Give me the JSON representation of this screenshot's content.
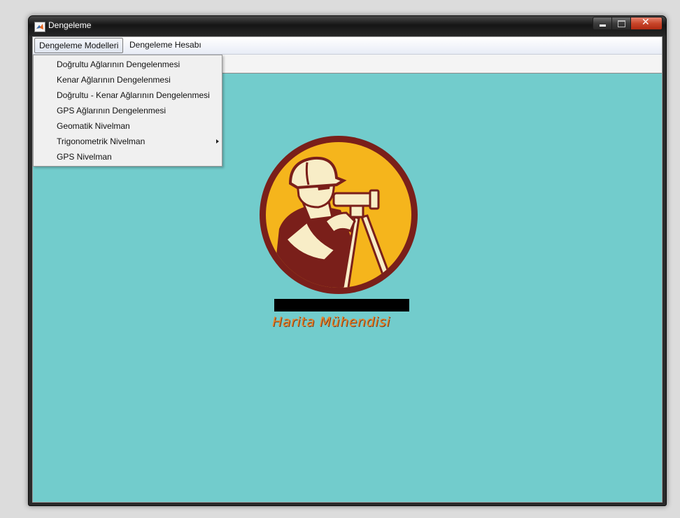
{
  "window": {
    "title": "Dengeleme",
    "close_glyph": "✕"
  },
  "menubar": {
    "items": [
      {
        "label": "Dengeleme Modelleri"
      },
      {
        "label": "Dengeleme Hesabı"
      }
    ]
  },
  "dropdown": {
    "items": [
      {
        "label": "Doğrultu Ağlarının Dengelenmesi",
        "submenu": false
      },
      {
        "label": "Kenar Ağlarının Dengelenmesi",
        "submenu": false
      },
      {
        "label": "Doğrultu - Kenar Ağlarının Dengelenmesi",
        "submenu": false
      },
      {
        "label": "GPS Ağlarının Dengelenmesi",
        "submenu": false
      },
      {
        "label": "Geomatik Nivelman",
        "submenu": false
      },
      {
        "label": "Trigonometrik Nivelman",
        "submenu": true
      },
      {
        "label": "GPS Nivelman",
        "submenu": false
      }
    ]
  },
  "logo": {
    "icon": "surveyor-icon",
    "caption": "Harita Mühendisi",
    "colors": {
      "ring": "#7a1f1a",
      "fill": "#f5b51c",
      "skin": "#f8edc7"
    }
  },
  "colors": {
    "background": "#72cccc",
    "titlebar": "#1e1e1e",
    "close_button": "#c8452a"
  }
}
